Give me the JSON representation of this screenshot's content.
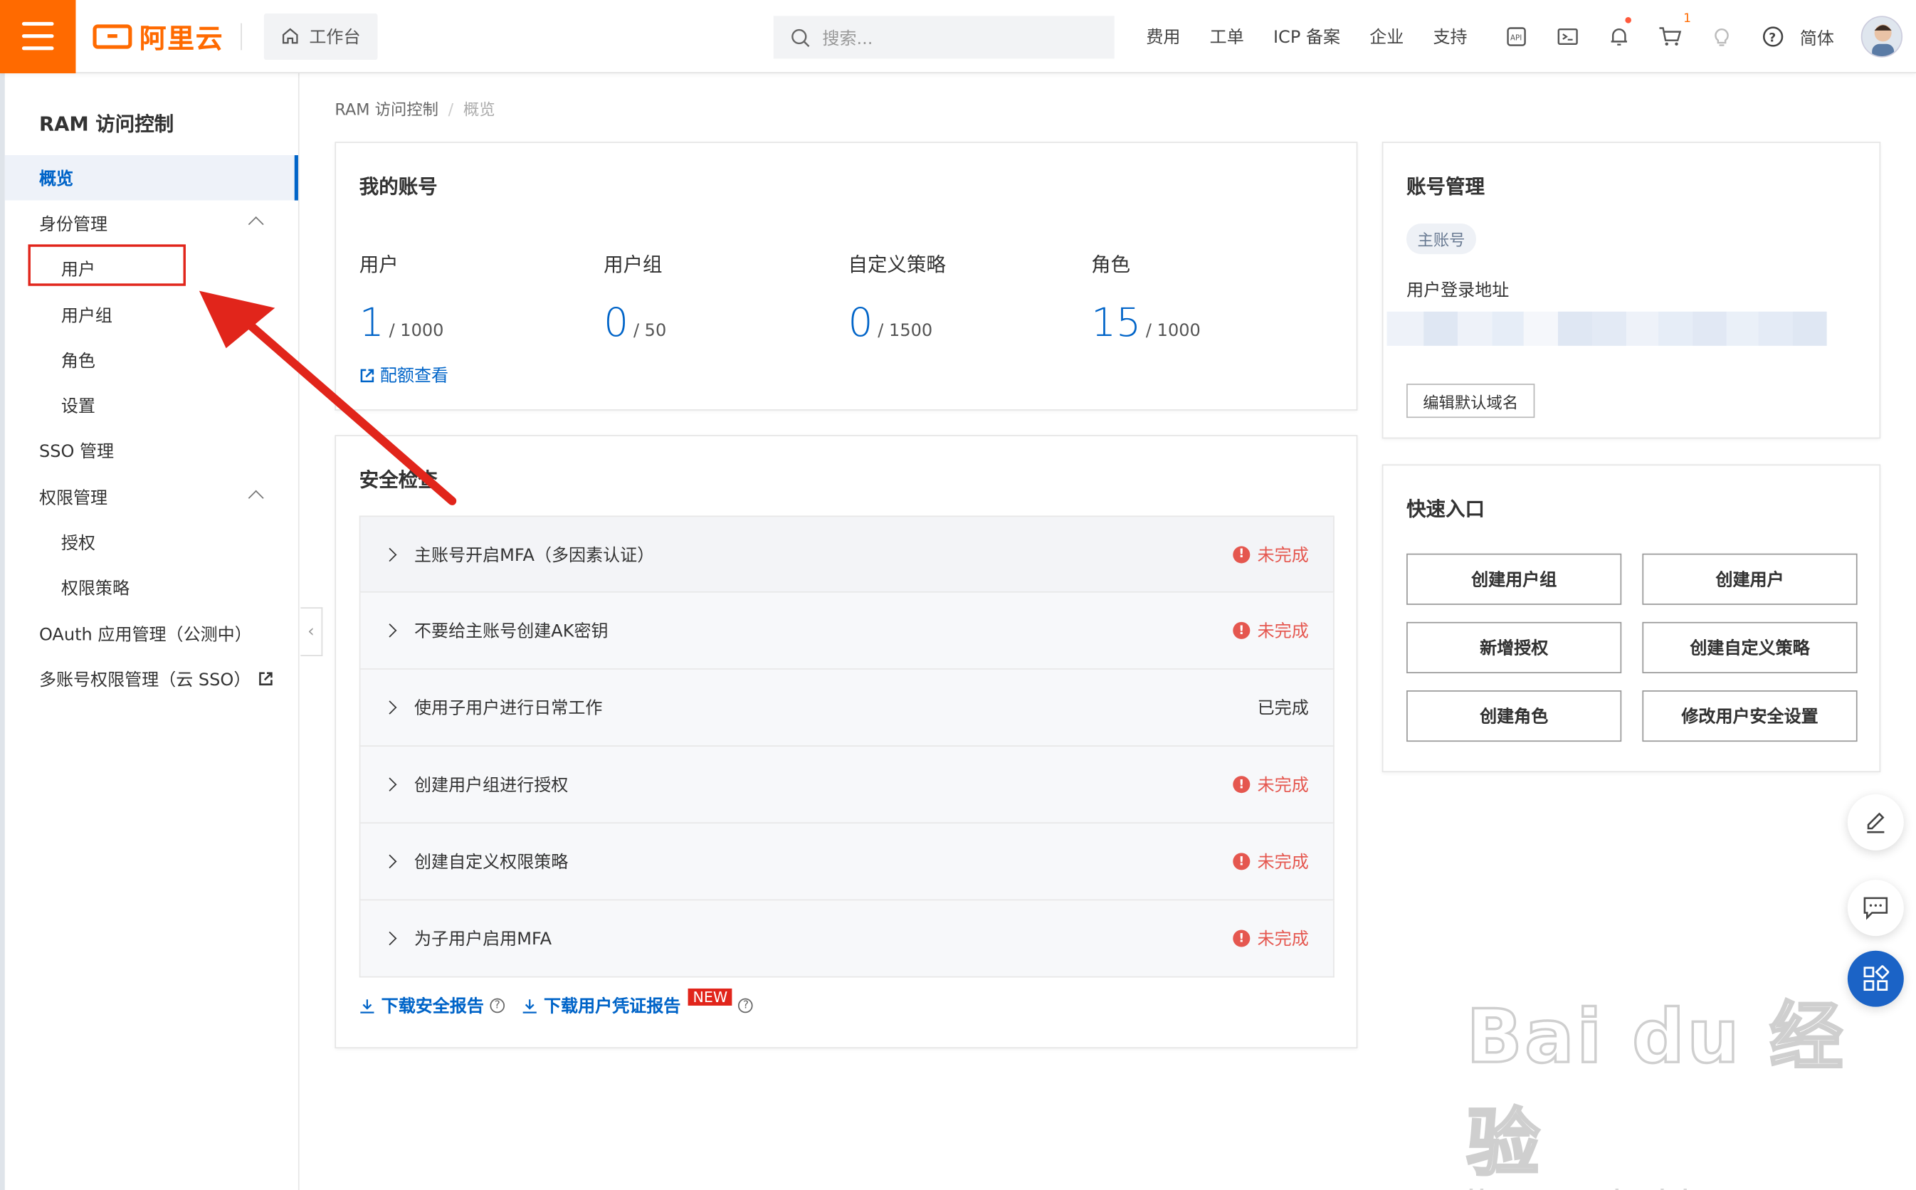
{
  "topbar": {
    "logo": "阿里云",
    "workbench": "工作台",
    "search_placeholder": "搜索...",
    "nav": [
      "费用",
      "工单",
      "ICP 备案",
      "企业",
      "支持"
    ],
    "cart_count": "1",
    "lang": "简体"
  },
  "sidebar": {
    "title": "RAM 访问控制",
    "items": [
      {
        "label": "概览"
      },
      {
        "label": "身份管理"
      },
      {
        "label": "用户"
      },
      {
        "label": "用户组"
      },
      {
        "label": "角色"
      },
      {
        "label": "设置"
      },
      {
        "label": "SSO 管理"
      },
      {
        "label": "权限管理"
      },
      {
        "label": "授权"
      },
      {
        "label": "权限策略"
      },
      {
        "label": "OAuth 应用管理（公测中）"
      },
      {
        "label": "多账号权限管理（云 SSO）"
      }
    ]
  },
  "breadcrumb": {
    "root": "RAM 访问控制",
    "sep": "/",
    "current": "概览"
  },
  "account": {
    "title": "我的账号",
    "stats": [
      {
        "label": "用户",
        "value": "1",
        "total": "/ 1000"
      },
      {
        "label": "用户组",
        "value": "0",
        "total": "/ 50"
      },
      {
        "label": "自定义策略",
        "value": "0",
        "total": "/ 1500"
      },
      {
        "label": "角色",
        "value": "15",
        "total": "/ 1000"
      }
    ],
    "quota_link": "配额查看"
  },
  "security": {
    "title": "安全检查",
    "rows": [
      {
        "label": "主账号开启MFA（多因素认证）",
        "status": "未完成"
      },
      {
        "label": "不要给主账号创建AK密钥",
        "status": "未完成"
      },
      {
        "label": "使用子用户进行日常工作",
        "status": "已完成"
      },
      {
        "label": "创建用户组进行授权",
        "status": "未完成"
      },
      {
        "label": "创建自定义权限策略",
        "status": "未完成"
      },
      {
        "label": "为子用户启用MFA",
        "status": "未完成"
      }
    ],
    "download_report": "下载安全报告",
    "download_credential": "下载用户凭证报告",
    "new_badge": "NEW"
  },
  "account_mgmt": {
    "title": "账号管理",
    "tag": "主账号",
    "login_label": "用户登录地址",
    "edit_button": "编辑默认域名"
  },
  "quick": {
    "title": "快速入口",
    "buttons": [
      "创建用户组",
      "创建用户",
      "新增授权",
      "创建自定义策略",
      "创建角色",
      "修改用户安全设置"
    ]
  },
  "watermark": {
    "big": "Bai du 经验",
    "small": "jingyan.baidu.com"
  },
  "colors": {
    "brand": "#ff6a00",
    "primary": "#0064c8",
    "danger": "#e5574f",
    "annotation": "#e1251b"
  }
}
